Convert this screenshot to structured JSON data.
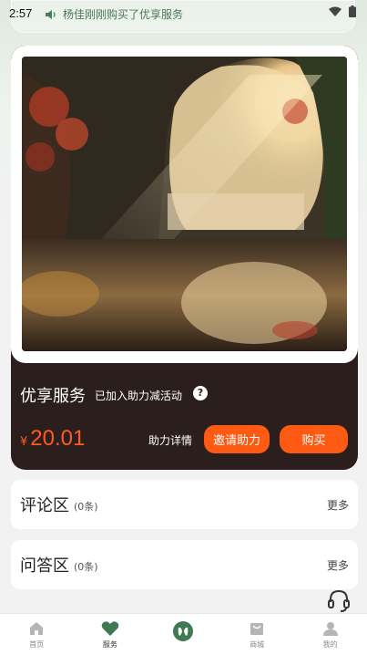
{
  "status_bar": {
    "time": "2:57"
  },
  "notice": {
    "text": "杨佳刚刚购买了优享服务"
  },
  "product": {
    "title": "优享服务",
    "subtitle": "已加入助力减活动",
    "help_icon": "?",
    "price_symbol": "¥",
    "price_value": "20.01",
    "assist_detail_label": "助力详情",
    "invite_label": "邀请助力",
    "buy_label": "购买"
  },
  "sections": [
    {
      "title": "评论区",
      "count": "(0条)",
      "more": "更多"
    },
    {
      "title": "问答区",
      "count": "(0条)",
      "more": "更多"
    }
  ],
  "tabbar": {
    "items": [
      {
        "label": "首页",
        "icon": "home-icon"
      },
      {
        "label": "服务",
        "icon": "heart-icon"
      },
      {
        "label": "",
        "icon": "center-logo-icon"
      },
      {
        "label": "商城",
        "icon": "shop-icon"
      },
      {
        "label": "我的",
        "icon": "profile-icon"
      }
    ],
    "active_index": 1
  },
  "colors": {
    "accent": "#ff5a14",
    "card_dark": "#2b1f1d",
    "brand_green": "#3f7a55",
    "price": "#ff5a1f"
  }
}
